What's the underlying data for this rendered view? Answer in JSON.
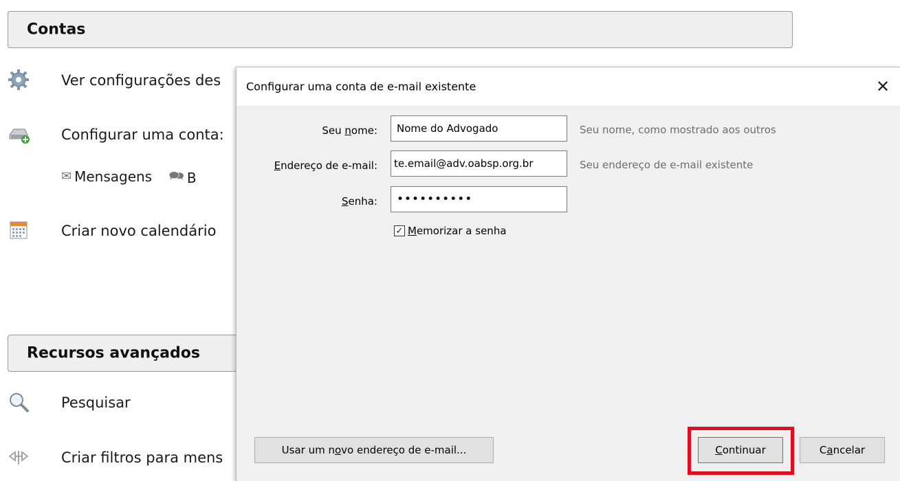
{
  "background": {
    "contas_header": "Contas",
    "items": [
      {
        "label": "Ver configurações des",
        "icon": "gear-icon"
      },
      {
        "label": "Configurar uma conta:",
        "icon": "add-account-icon"
      },
      {
        "label": "Criar novo calendário",
        "icon": "calendar-icon"
      }
    ],
    "sub_items": [
      {
        "label": "Mensagens",
        "icon": "mail-envelope-icon"
      },
      {
        "label": "B",
        "icon": "chat-icon"
      }
    ],
    "recursos_header": "Recursos avançados",
    "advanced_items": [
      {
        "label": "Pesquisar",
        "icon": "magnifier-icon"
      },
      {
        "label": "Criar filtros para mens",
        "icon": "filter-icon"
      }
    ]
  },
  "dialog": {
    "title": "Configurar uma conta de e-mail existente",
    "fields": {
      "name": {
        "label": "Seu nome:",
        "value": "Nome do Advogado",
        "hint": "Seu nome, como mostrado aos outros"
      },
      "email": {
        "label": "Endereço de e-mail:",
        "value": "te.email@adv.oabsp.org.br",
        "hint": "Seu endereço de e-mail existente"
      },
      "password": {
        "label": "Senha:",
        "value": "••••••••••"
      }
    },
    "remember_password": {
      "label": "Memorizar a senha",
      "checked": true
    },
    "buttons": {
      "new_address": "Usar um novo endereço de e-mail...",
      "continue": "Continuar",
      "cancel": "Cancelar"
    }
  },
  "colors": {
    "highlight": "#e00e1f"
  }
}
